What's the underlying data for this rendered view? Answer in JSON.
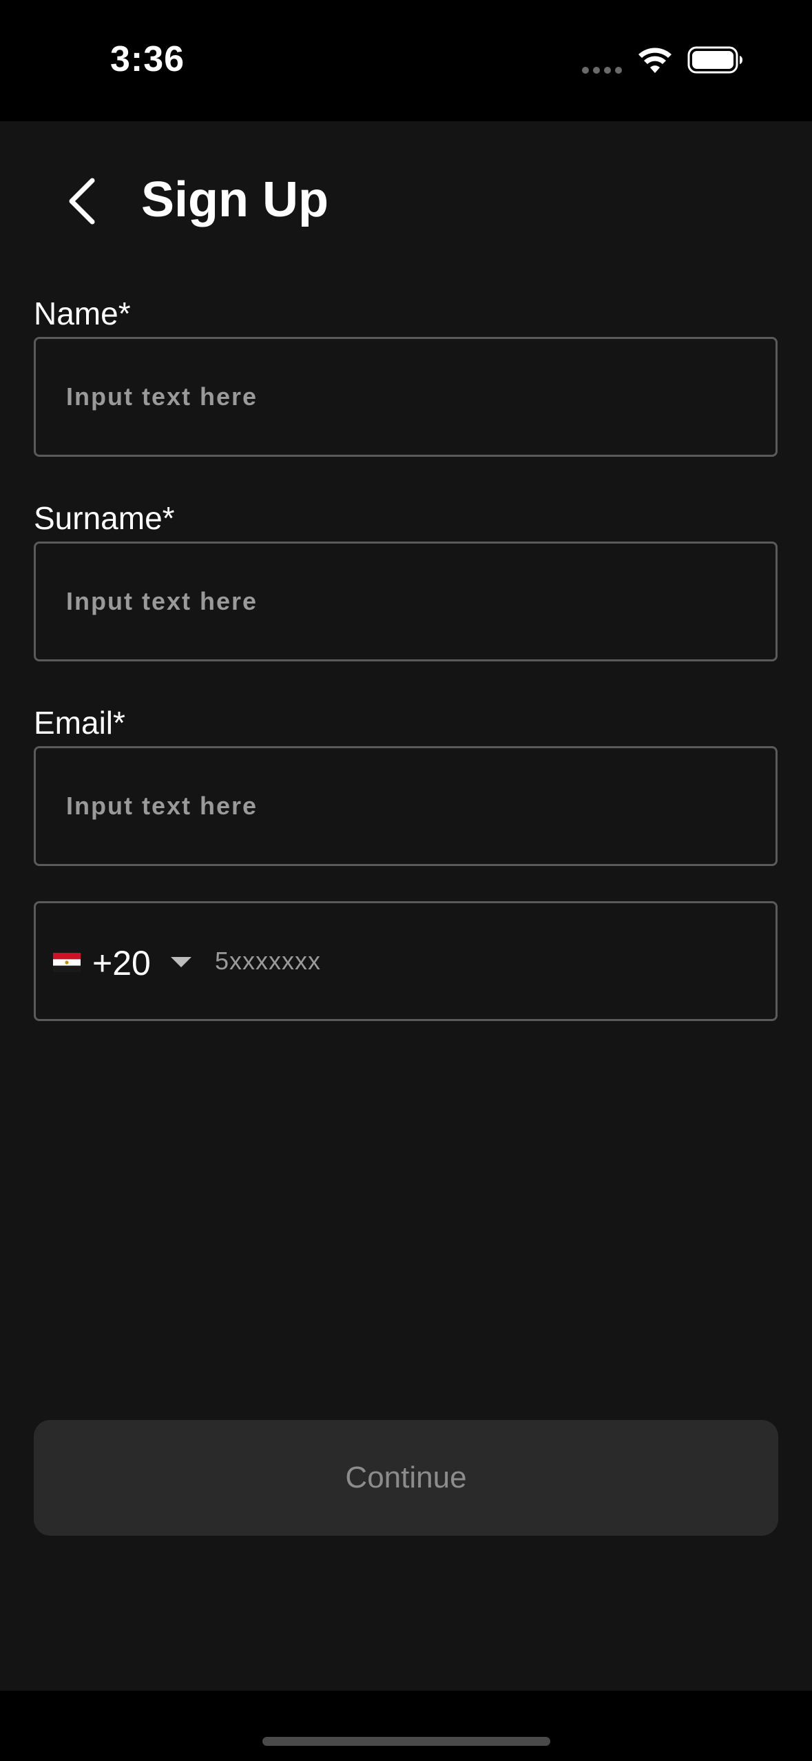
{
  "status_bar": {
    "time": "3:36"
  },
  "header": {
    "title": "Sign Up",
    "back_icon": "chevron-left-icon"
  },
  "form": {
    "name": {
      "label": "Name*",
      "placeholder": "Input text here",
      "value": ""
    },
    "surname": {
      "label": "Surname*",
      "placeholder": "Input text here",
      "value": ""
    },
    "email": {
      "label": "Email*",
      "placeholder": "Input text here",
      "value": ""
    },
    "phone": {
      "country_flag": "egypt-flag-icon",
      "dial_code": "+20",
      "placeholder": "5xxxxxxx",
      "value": ""
    }
  },
  "actions": {
    "continue_label": "Continue"
  },
  "colors": {
    "background": "#141414",
    "field_border": "#5a5a5a",
    "placeholder": "#9a9a9a",
    "button_disabled_bg": "#2a2a2a",
    "button_disabled_text": "#8c8c8c"
  }
}
